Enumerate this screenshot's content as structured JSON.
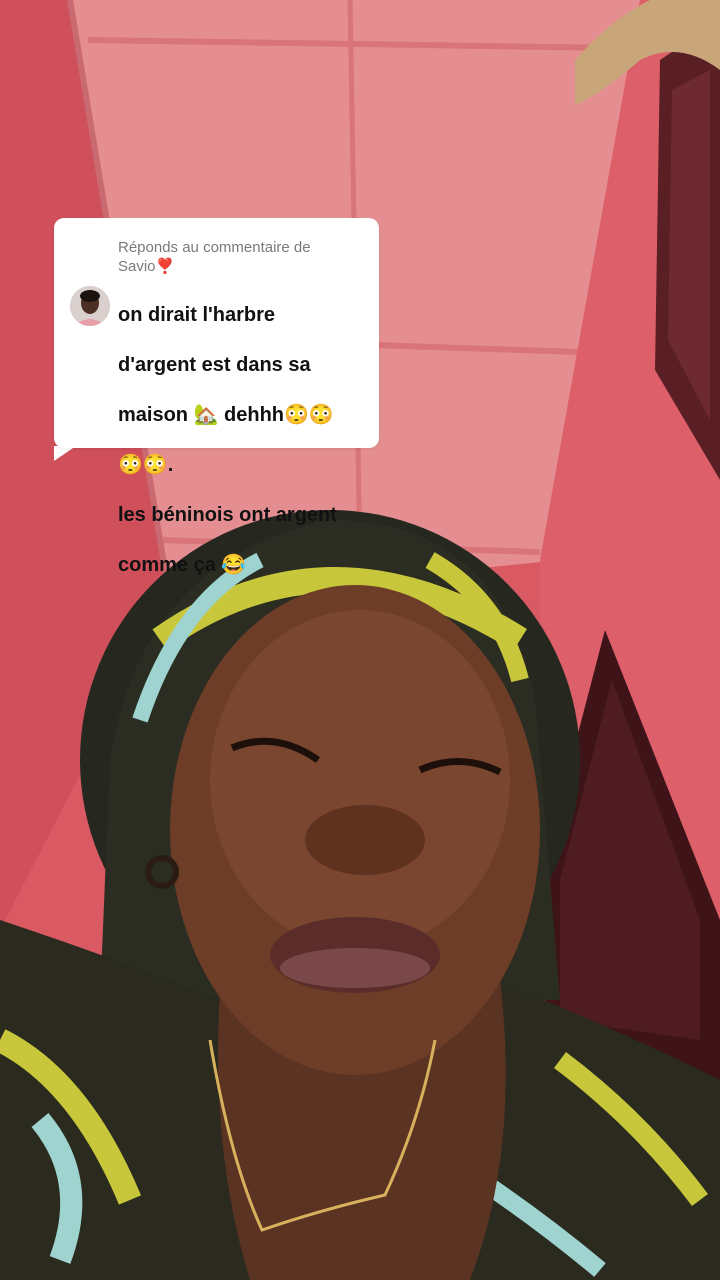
{
  "reply": {
    "header_prefix": "Réponds au commentaire de",
    "username": "Savio",
    "heart_icon": "❣️",
    "comment_lines": [
      "on dirait l'harbre",
      "d'argent est dans sa",
      "maison 🏡 dehhh😳😳",
      "😳😳.",
      "les béninois ont argent",
      "comme ça 😂"
    ]
  },
  "colors": {
    "wall": "#d95a63",
    "ceiling": "#e48a8e",
    "bubble": "#ffffff",
    "bubble_text": "#111111",
    "header_text": "#7a7a7a",
    "heart": "#e0262e"
  }
}
